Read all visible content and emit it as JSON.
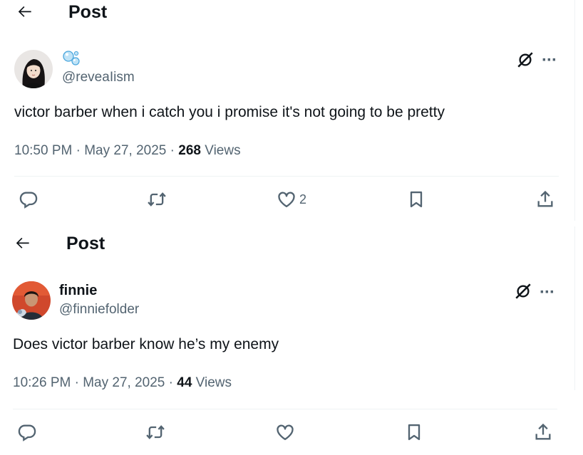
{
  "posts": [
    {
      "header_title": "Post",
      "author_name": "",
      "name_emoji": "bubbles-icon",
      "handle": "@reveaIism",
      "text": "victor barber when i catch you i promise it's not going to be pretty",
      "time": "10:50 PM",
      "date": "May 27, 2025",
      "views_count": "268",
      "views_label": "Views",
      "like_count": "2"
    },
    {
      "header_title": "Post",
      "author_name": "finnie",
      "handle": "@finniefolder",
      "text": "Does victor barber know he’s my enemy",
      "time": "10:26 PM",
      "date": "May 27, 2025",
      "views_count": "44",
      "views_label": "Views",
      "like_count": ""
    }
  ],
  "separator": "·",
  "icons": [
    "back-arrow-icon",
    "grok-icon",
    "more-icon",
    "reply-icon",
    "repost-icon",
    "like-icon",
    "bookmark-icon",
    "share-icon"
  ]
}
